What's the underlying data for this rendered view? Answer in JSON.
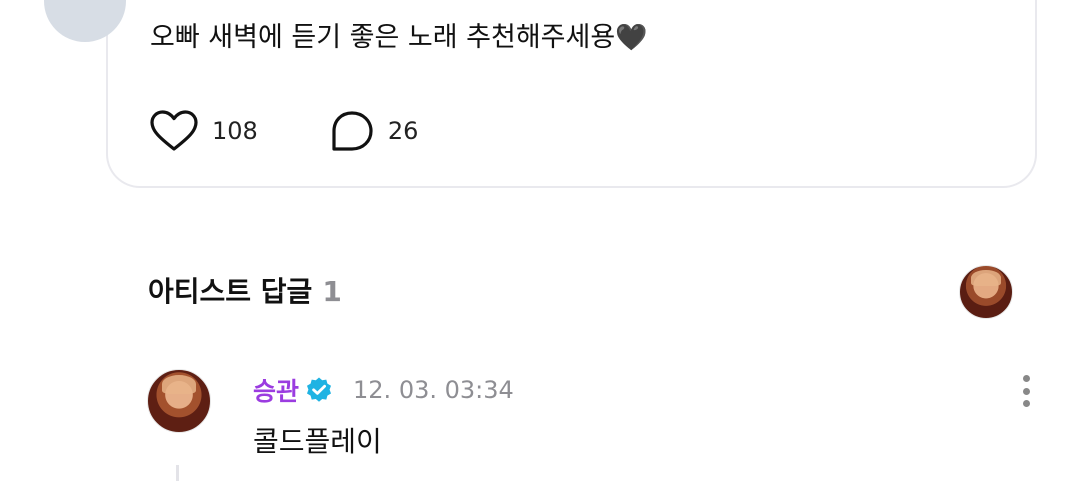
{
  "post": {
    "text": "오빠 새벽에 듣기 좋은 노래 추천해주세용",
    "heart_emoji": "🖤",
    "like_icon": "heart-outline-icon",
    "like_count": "108",
    "comment_icon": "speech-bubble-icon",
    "comment_count": "26"
  },
  "artist_replies": {
    "title": "아티스트 답글",
    "count": "1"
  },
  "reply": {
    "author": "승관",
    "verified_icon": "verified-badge-icon",
    "timestamp": "12. 03. 03:34",
    "text": "콜드플레이",
    "more_icon": "more-vertical-icon"
  },
  "colors": {
    "author_name": "#9b3ce0",
    "verified_badge": "#1fb3e3",
    "muted_text": "#8e8e93",
    "card_border": "#e9e9ee"
  }
}
